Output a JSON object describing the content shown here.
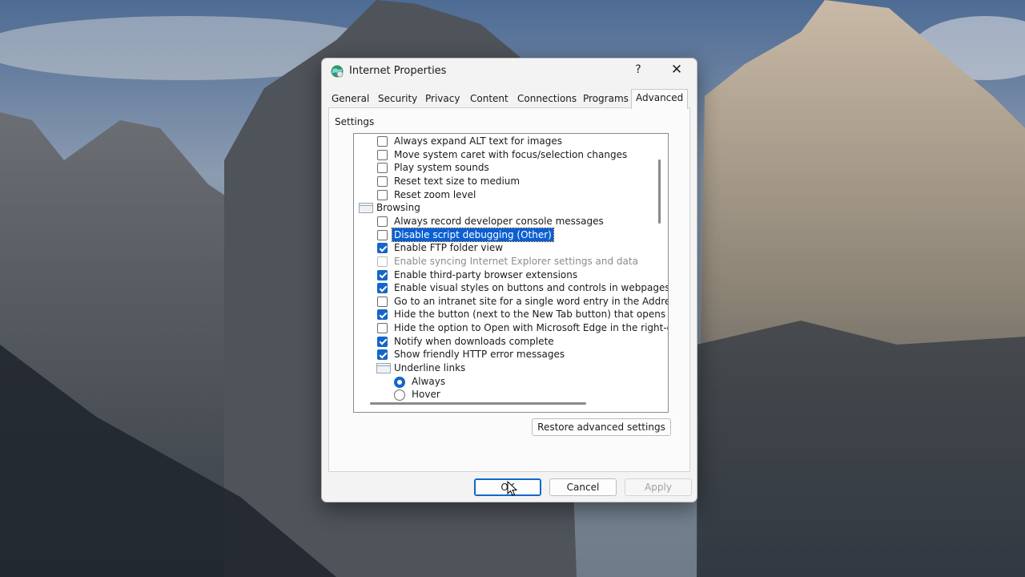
{
  "dialog": {
    "title": "Internet Properties",
    "help_glyph": "?",
    "close_glyph": "✕",
    "icon": "internet-globe-icon"
  },
  "tabs": [
    {
      "label": "General",
      "active": false
    },
    {
      "label": "Security",
      "active": false
    },
    {
      "label": "Privacy",
      "active": false
    },
    {
      "label": "Content",
      "active": false
    },
    {
      "label": "Connections",
      "active": false
    },
    {
      "label": "Programs",
      "active": false
    },
    {
      "label": "Advanced",
      "active": true
    }
  ],
  "settings": {
    "label": "Settings",
    "items": [
      {
        "kind": "checkbox",
        "label": "Always expand ALT text for images",
        "checked": false
      },
      {
        "kind": "checkbox",
        "label": "Move system caret with focus/selection changes",
        "checked": false
      },
      {
        "kind": "checkbox",
        "label": "Play system sounds",
        "checked": false
      },
      {
        "kind": "checkbox",
        "label": "Reset text size to medium",
        "checked": false
      },
      {
        "kind": "checkbox",
        "label": "Reset zoom level",
        "checked": false
      },
      {
        "kind": "group",
        "label": "Browsing"
      },
      {
        "kind": "checkbox",
        "label": "Always record developer console messages",
        "checked": false
      },
      {
        "kind": "checkbox",
        "label": "Disable script debugging (Other)",
        "checked": false,
        "selected": true
      },
      {
        "kind": "checkbox",
        "label": "Enable FTP folder view",
        "checked": true
      },
      {
        "kind": "checkbox",
        "label": "Enable syncing Internet Explorer settings and data",
        "checked": false,
        "disabled": true
      },
      {
        "kind": "checkbox",
        "label": "Enable third-party browser extensions",
        "checked": true
      },
      {
        "kind": "checkbox",
        "label": "Enable visual styles on buttons and controls in webpages",
        "checked": true
      },
      {
        "kind": "checkbox",
        "label": "Go to an intranet site for a single word entry in the Addres",
        "checked": false
      },
      {
        "kind": "checkbox",
        "label": "Hide the button (next to the New Tab button) that opens",
        "checked": true
      },
      {
        "kind": "checkbox",
        "label": "Hide the option to Open with Microsoft Edge in the right-cl",
        "checked": false
      },
      {
        "kind": "checkbox",
        "label": "Notify when downloads complete",
        "checked": true
      },
      {
        "kind": "checkbox",
        "label": "Show friendly HTTP error messages",
        "checked": true
      },
      {
        "kind": "subgroup",
        "label": "Underline links"
      },
      {
        "kind": "radio",
        "label": "Always",
        "checked": true
      },
      {
        "kind": "radio",
        "label": "Hover",
        "checked": false
      }
    ]
  },
  "buttons": {
    "restore": "Restore advanced settings",
    "ok": "OK",
    "cancel": "Cancel",
    "apply": "Apply"
  },
  "colors": {
    "accent": "#1566c8",
    "selection": "#0a5fd3"
  }
}
